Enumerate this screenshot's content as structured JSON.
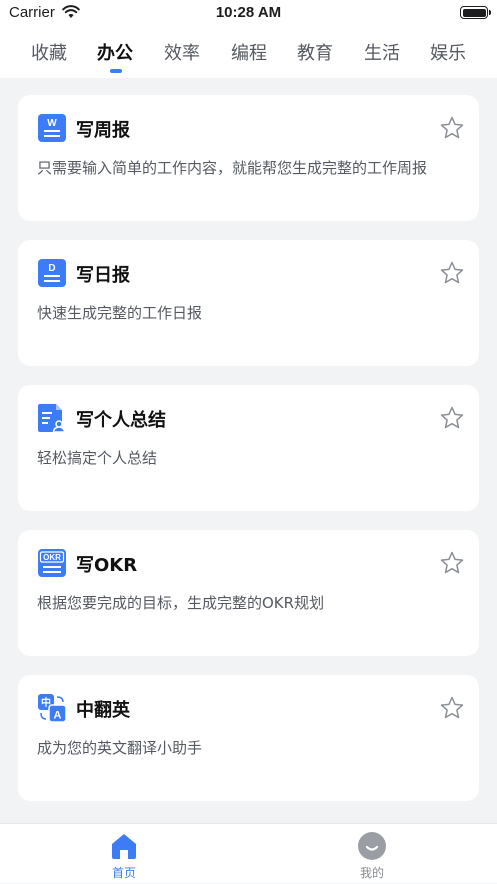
{
  "status_bar": {
    "carrier": "Carrier",
    "time": "10:28 AM"
  },
  "tabs": [
    {
      "label": "收藏",
      "active": false
    },
    {
      "label": "办公",
      "active": true
    },
    {
      "label": "效率",
      "active": false
    },
    {
      "label": "编程",
      "active": false
    },
    {
      "label": "教育",
      "active": false
    },
    {
      "label": "生活",
      "active": false
    },
    {
      "label": "娱乐",
      "active": false
    }
  ],
  "cards": [
    {
      "title": "写周报",
      "desc": "只需要输入简单的工作内容，就能帮您生成完整的工作周报",
      "icon": "weekly-report-icon",
      "icon_glyph": "W",
      "favorited": false
    },
    {
      "title": "写日报",
      "desc": "快速生成完整的工作日报",
      "icon": "daily-report-icon",
      "icon_glyph": "D",
      "favorited": false
    },
    {
      "title": "写个人总结",
      "desc": "轻松搞定个人总结",
      "icon": "personal-summary-icon",
      "icon_glyph": "",
      "favorited": false
    },
    {
      "title": "写OKR",
      "desc": "根据您要完成的目标，生成完整的OKR规划",
      "icon": "okr-icon",
      "icon_glyph": "OKR",
      "favorited": false
    },
    {
      "title": "中翻英",
      "desc": "成为您的英文翻译小助手",
      "icon": "translate-icon",
      "icon_glyph": "中 A",
      "favorited": false
    }
  ],
  "bottom_nav": {
    "home": {
      "label": "首页",
      "icon": "home-icon",
      "active": true
    },
    "mine": {
      "label": "我的",
      "icon": "profile-icon",
      "active": false
    }
  },
  "colors": {
    "accent": "#3c7cf6",
    "background": "#f2f3f5",
    "card": "#ffffff",
    "text_secondary": "#555a62"
  }
}
